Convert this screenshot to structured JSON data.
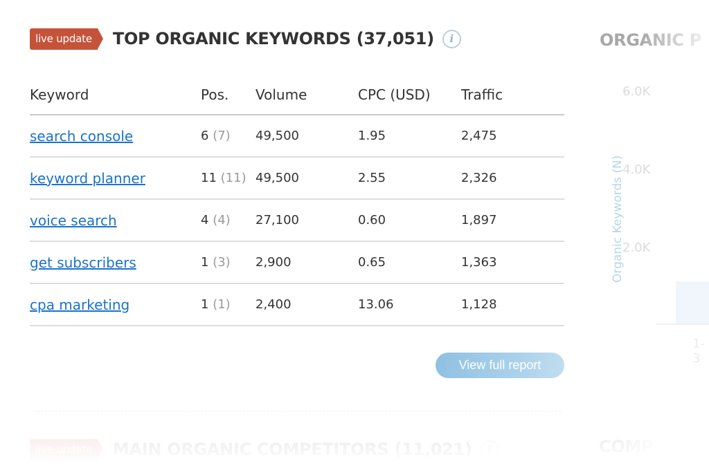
{
  "top_keywords_widget": {
    "badge": "live update",
    "title": "TOP ORGANIC KEYWORDS (37,051)",
    "info_icon": "info-icon",
    "columns": [
      "Keyword",
      "Pos.",
      "Volume",
      "CPC (USD)",
      "Traffic"
    ],
    "rows": [
      {
        "keyword": "search console",
        "pos": "6",
        "prev_pos": "(7)",
        "volume": "49,500",
        "cpc": "1.95",
        "traffic": "2,475"
      },
      {
        "keyword": "keyword planner",
        "pos": "11",
        "prev_pos": "(11)",
        "volume": "49,500",
        "cpc": "2.55",
        "traffic": "2,326"
      },
      {
        "keyword": "voice search",
        "pos": "4",
        "prev_pos": "(4)",
        "volume": "27,100",
        "cpc": "0.60",
        "traffic": "1,897"
      },
      {
        "keyword": "get subscribers",
        "pos": "1",
        "prev_pos": "(3)",
        "volume": "2,900",
        "cpc": "0.65",
        "traffic": "1,363"
      },
      {
        "keyword": "cpa marketing",
        "pos": "1",
        "prev_pos": "(1)",
        "volume": "2,400",
        "cpc": "13.06",
        "traffic": "1,128"
      }
    ],
    "view_full_report": "View full report"
  },
  "organic_positions_panel": {
    "title": "ORGANIC P",
    "y_axis_label": "Organic Keywords (N)",
    "y_ticks": [
      "6.0K",
      "4.0K",
      "2.0K"
    ],
    "x_ticks": [
      "1-3"
    ],
    "bars": [
      {
        "label": "1-3",
        "value_fraction_of_max": 0.1
      }
    ]
  },
  "competitors_widget": {
    "badge": "live update",
    "title": "MAIN ORGANIC COMPETITORS (11,021)",
    "right_title": "COMP"
  },
  "colors": {
    "badge": "#c4533a",
    "link": "#1a73c8",
    "button": "#8fc0e2",
    "axis_label": "#b7d5ec"
  }
}
